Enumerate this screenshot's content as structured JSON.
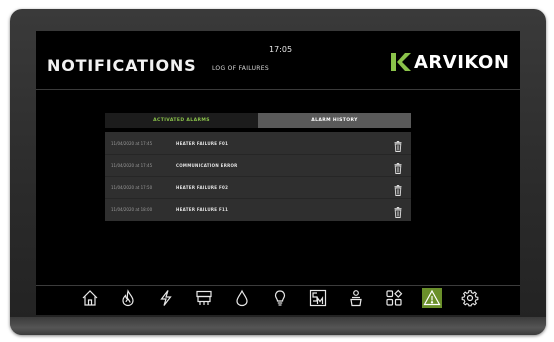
{
  "header": {
    "title": "NOTIFICATIONS",
    "subtitle": "LOG OF FAILURES",
    "clock": "17:05",
    "logo_text": "ARVIKON",
    "logo_color": "#8bc34a"
  },
  "tabs": [
    {
      "label": "ACTIVATED ALARMS",
      "active": true
    },
    {
      "label": "ALARM HISTORY",
      "active": false
    }
  ],
  "alarms": [
    {
      "time": "11/04/2020 at 17:45",
      "message": "HEATER FAILURE F01"
    },
    {
      "time": "11/04/2020 at 17:45",
      "message": "COMMUNICATION ERROR"
    },
    {
      "time": "11/04/2020 at 17:50",
      "message": "HEATER FAILURE F02"
    },
    {
      "time": "11/04/2020 at 18:00",
      "message": "HEATER FAILURE F11"
    }
  ],
  "navbar": {
    "items": [
      "home-icon",
      "fire-icon",
      "lightning-icon",
      "oven-icon",
      "water-drop-icon",
      "bulb-icon",
      "sm-icon",
      "person-pot-icon",
      "apps-icon",
      "warning-icon",
      "gear-icon"
    ],
    "active": "warning-icon"
  },
  "colors": {
    "accent": "#8bc34a",
    "active_nav": "#6a8f2a"
  }
}
